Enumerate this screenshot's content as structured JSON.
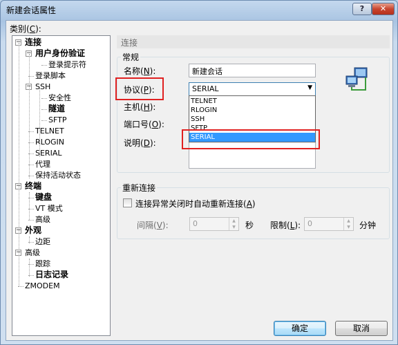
{
  "window": {
    "title": "新建会话属性",
    "help_label": "?",
    "close_label": "✕"
  },
  "category": {
    "label": "类别(",
    "mnemonic": "C",
    "suffix": "):"
  },
  "tree": [
    {
      "id": "conn",
      "label": "连接",
      "bold": true,
      "expander": "−"
    },
    {
      "id": "auth",
      "label": "用户身份验证",
      "bold": true,
      "expander": "−"
    },
    {
      "id": "login-prompts",
      "label": "登录提示符"
    },
    {
      "id": "login-script",
      "label": "登录脚本"
    },
    {
      "id": "ssh",
      "label": "SSH",
      "expander": "−"
    },
    {
      "id": "security",
      "label": "安全性"
    },
    {
      "id": "tunnel",
      "label": "隧道",
      "bold": true
    },
    {
      "id": "sftp",
      "label": "SFTP"
    },
    {
      "id": "telnet",
      "label": "TELNET"
    },
    {
      "id": "rlogin",
      "label": "RLOGIN"
    },
    {
      "id": "serial",
      "label": "SERIAL"
    },
    {
      "id": "proxy",
      "label": "代理"
    },
    {
      "id": "keepalive",
      "label": "保持活动状态"
    },
    {
      "id": "terminal",
      "label": "终端",
      "bold": true,
      "expander": "−"
    },
    {
      "id": "keyboard",
      "label": "键盘",
      "bold": true
    },
    {
      "id": "vt-mode",
      "label": "VT 模式"
    },
    {
      "id": "advanced1",
      "label": "高级"
    },
    {
      "id": "appearance",
      "label": "外观",
      "bold": true,
      "expander": "−"
    },
    {
      "id": "margin",
      "label": "边距"
    },
    {
      "id": "advanced2",
      "label": "高级",
      "expander": "−"
    },
    {
      "id": "trace",
      "label": "跟踪"
    },
    {
      "id": "log",
      "label": "日志记录",
      "bold": true
    },
    {
      "id": "zmodem",
      "label": "ZMODEM"
    }
  ],
  "section_header": "连接",
  "general": {
    "title": "常规",
    "name_label": "名称(",
    "name_mn": "N",
    "name_suffix": "):",
    "name_value": "新建会话",
    "protocol_label": "协议(",
    "protocol_mn": "P",
    "protocol_suffix": "):",
    "protocol_value": "SERIAL",
    "protocol_options": [
      "TELNET",
      "RLOGIN",
      "SSH",
      "SFTP",
      "SERIAL"
    ],
    "host_label": "主机(",
    "host_mn": "H",
    "host_suffix": "):",
    "port_label": "端口号(",
    "port_mn": "O",
    "port_suffix": "):",
    "desc_label": "说明(",
    "desc_mn": "D",
    "desc_suffix": "):"
  },
  "reconnect": {
    "title": "重新连接",
    "checkbox_label": "连接异常关闭时自动重新连接(",
    "checkbox_mn": "A",
    "checkbox_suffix": ")",
    "interval_label": "间隔(",
    "interval_mn": "V",
    "interval_suffix": "):",
    "interval_value": "0",
    "interval_unit": "秒",
    "limit_label": "限制(",
    "limit_mn": "L",
    "limit_suffix": "):",
    "limit_value": "0",
    "limit_unit": "分钟"
  },
  "buttons": {
    "ok": "确定",
    "cancel": "取消"
  },
  "colors": {
    "highlight": "#3399ff",
    "annotation_red": "#e02020"
  }
}
